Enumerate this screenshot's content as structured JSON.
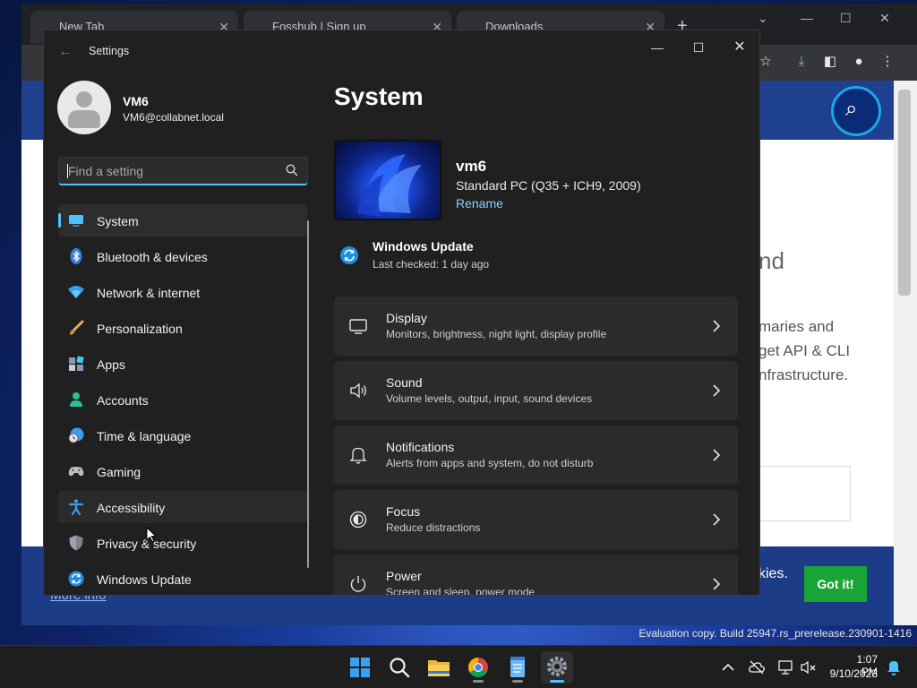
{
  "browser": {
    "tabs": [
      {
        "label": "New Tab"
      },
      {
        "label": "Fosshub | Sign up"
      },
      {
        "label": "Downloads"
      }
    ],
    "page": {
      "heading_fragment": "nd",
      "text_lines": [
        "maries and",
        "get API & CLI",
        "nfrastructure."
      ],
      "cookie_text": "kies.",
      "cookie_button": "Got it!",
      "more_info": "More info"
    }
  },
  "settings": {
    "window_title": "Settings",
    "user": {
      "name": "VM6",
      "email": "VM6@collabnet.local"
    },
    "search": {
      "placeholder": "Find a setting"
    },
    "nav": [
      {
        "label": "System",
        "icon": "monitor-icon",
        "state": "active"
      },
      {
        "label": "Bluetooth & devices",
        "icon": "bluetooth-icon"
      },
      {
        "label": "Network & internet",
        "icon": "wifi-icon"
      },
      {
        "label": "Personalization",
        "icon": "brush-icon"
      },
      {
        "label": "Apps",
        "icon": "apps-icon"
      },
      {
        "label": "Accounts",
        "icon": "person-icon"
      },
      {
        "label": "Time & language",
        "icon": "globe-clock-icon"
      },
      {
        "label": "Gaming",
        "icon": "gamepad-icon"
      },
      {
        "label": "Accessibility",
        "icon": "accessibility-icon",
        "state": "hover"
      },
      {
        "label": "Privacy & security",
        "icon": "shield-icon"
      },
      {
        "label": "Windows Update",
        "icon": "update-icon"
      }
    ],
    "main": {
      "title": "System",
      "device": {
        "name": "vm6",
        "model": "Standard PC (Q35 + ICH9, 2009)",
        "rename_label": "Rename"
      },
      "windows_update": {
        "title": "Windows Update",
        "status": "Last checked: 1 day ago"
      },
      "cards": [
        {
          "title": "Display",
          "subtitle": "Monitors, brightness, night light, display profile",
          "icon": "display-icon"
        },
        {
          "title": "Sound",
          "subtitle": "Volume levels, output, input, sound devices",
          "icon": "speaker-icon"
        },
        {
          "title": "Notifications",
          "subtitle": "Alerts from apps and system, do not disturb",
          "icon": "bell-icon"
        },
        {
          "title": "Focus",
          "subtitle": "Reduce distractions",
          "icon": "focus-icon"
        },
        {
          "title": "Power",
          "subtitle": "Screen and sleep, power mode",
          "icon": "power-icon"
        }
      ]
    }
  },
  "watermark": "Evaluation copy. Build 25947.rs_prerelease.230901-1416",
  "taskbar": {
    "apps": [
      "start-icon",
      "search-icon",
      "file-explorer-icon",
      "chrome-icon",
      "notepad-icon",
      "settings-icon"
    ],
    "clock": {
      "time": "1:07 PM",
      "date": "9/10/2023"
    }
  },
  "colors": {
    "accent": "#4cc2ff",
    "window_bg": "#202020",
    "card_bg": "#2b2b2b",
    "got_it": "#1aa537"
  }
}
